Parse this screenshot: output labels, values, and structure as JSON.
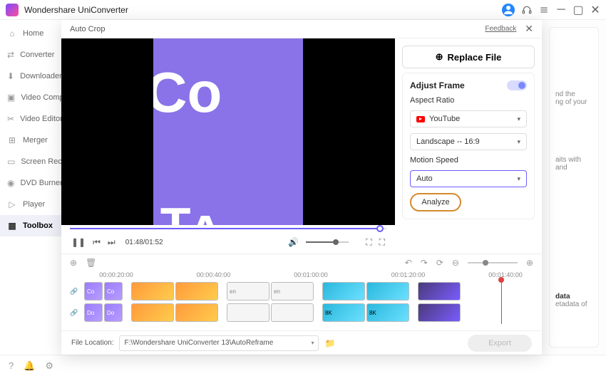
{
  "titlebar": {
    "title": "Wondershare UniConverter"
  },
  "sidebar": {
    "items": [
      {
        "label": "Home"
      },
      {
        "label": "Converter"
      },
      {
        "label": "Downloader"
      },
      {
        "label": "Video Compressor"
      },
      {
        "label": "Video Editor"
      },
      {
        "label": "Merger"
      },
      {
        "label": "Screen Recorder"
      },
      {
        "label": "DVD Burner"
      },
      {
        "label": "Player"
      },
      {
        "label": "Toolbox"
      }
    ]
  },
  "modal": {
    "title": "Auto Crop",
    "feedback": "Feedback",
    "time": "01:48/01:52",
    "replace_label": "Replace File",
    "adjust_frame": "Adjust Frame",
    "aspect_ratio_label": "Aspect Ratio",
    "aspect_platform": "YouTube",
    "aspect_value": "Landscape -- 16:9",
    "motion_speed_label": "Motion Speed",
    "motion_speed_value": "Auto",
    "analyze_label": "Analyze"
  },
  "timeline": {
    "ticks": [
      "00:00:20:00",
      "00:00:40:00",
      "00:01:00:00",
      "00:01:20:00",
      "00:01:40:00"
    ],
    "clips_row1": [
      "Co",
      "Co",
      "",
      "",
      "",
      "en",
      "en",
      "",
      "",
      ""
    ],
    "clips_row2": [
      "Do",
      "Do",
      "",
      "",
      "",
      "",
      "",
      "8K",
      "8K",
      ""
    ]
  },
  "file": {
    "label": "File Location:",
    "path": "F:\\Wondershare UniConverter 13\\AutoReframe",
    "export": "Export"
  },
  "right_bg": {
    "t1": "nd the",
    "t2": "ng of your",
    "t3": "aits with",
    "t4": "and",
    "t5": "data",
    "t6": "etadata of"
  }
}
